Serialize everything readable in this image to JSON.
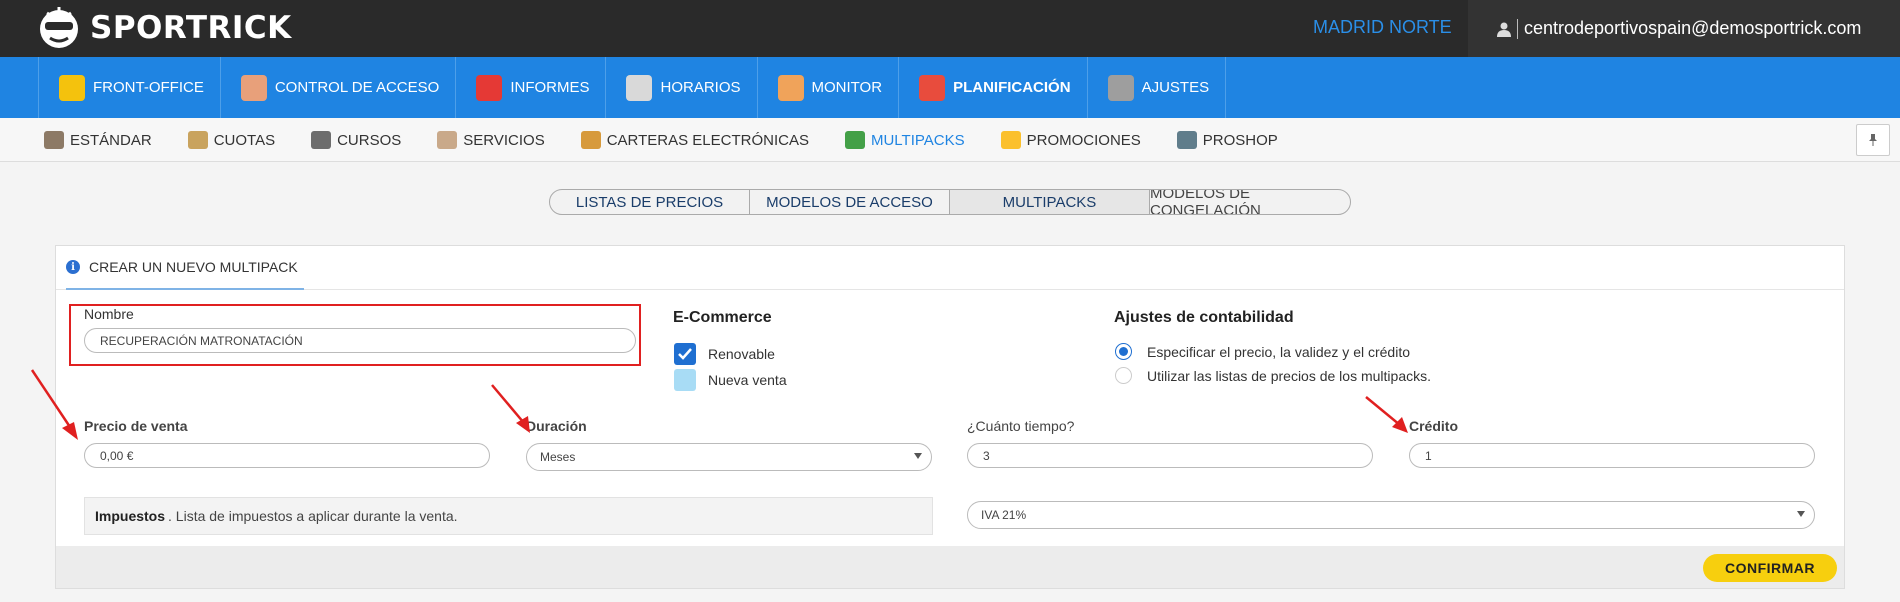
{
  "brand": {
    "name": "SPORTRICK"
  },
  "header": {
    "location": "MADRID NORTE",
    "user_email": "centrodeportivospain@demosportrick.com"
  },
  "main_nav": [
    {
      "label": "FRONT-OFFICE",
      "icon": "receptionist-icon",
      "color": "#f4c20d"
    },
    {
      "label": "CONTROL DE ACCESO",
      "icon": "turnstile-icon",
      "color": "#e8a07a"
    },
    {
      "label": "INFORMES",
      "icon": "pie-chart-icon",
      "color": "#e53935"
    },
    {
      "label": "HORARIOS",
      "icon": "calendar-icon",
      "color": "#d9d9d9"
    },
    {
      "label": "MONITOR",
      "icon": "people-icon",
      "color": "#f0a35a"
    },
    {
      "label": "PLANIFICACIÓN",
      "icon": "planner-calendar-icon",
      "color": "#e84c3d",
      "active": true
    },
    {
      "label": "AJUSTES",
      "icon": "gear-icon",
      "color": "#9e9e9e"
    }
  ],
  "sub_nav": [
    {
      "label": "ESTÁNDAR",
      "icon": "box-icon",
      "color": "#8d7a66"
    },
    {
      "label": "CUOTAS",
      "icon": "clipboard-icon",
      "color": "#c9a35e"
    },
    {
      "label": "CURSOS",
      "icon": "books-icon",
      "color": "#6d6d6d"
    },
    {
      "label": "SERVICIOS",
      "icon": "handshake-icon",
      "color": "#c9a98a"
    },
    {
      "label": "CARTERAS ELECTRÓNICAS",
      "icon": "wallet-icon",
      "color": "#d79a3c"
    },
    {
      "label": "MULTIPACKS",
      "icon": "multipack-icon",
      "color": "#43a047",
      "active": true
    },
    {
      "label": "PROMOCIONES",
      "icon": "star-icon",
      "color": "#fbc02d"
    },
    {
      "label": "PROSHOP",
      "icon": "cash-register-icon",
      "color": "#607d8b"
    }
  ],
  "pin_icon": "pin-icon",
  "segment_tabs": [
    {
      "label": "LISTAS DE PRECIOS"
    },
    {
      "label": "MODELOS DE ACCESO"
    },
    {
      "label": "MULTIPACKS",
      "active": true
    },
    {
      "label": "MODELOS DE CONGELACIÓN"
    }
  ],
  "card": {
    "title": "CREAR UN NUEVO MULTIPACK",
    "info_icon": "info-icon",
    "name_label": "Nombre",
    "name_value": "RECUPERACIÓN MATRONATACIÓN",
    "ecommerce": {
      "title": "E-Commerce",
      "renewable_label": "Renovable",
      "renewable_checked": true,
      "new_sale_label": "Nueva venta",
      "new_sale_checked": false
    },
    "accounting": {
      "title": "Ajustes de contabilidad",
      "option_specify": "Especificar el precio, la validez y el crédito",
      "option_lists": "Utilizar las listas de precios de los multipacks.",
      "selected": "specify"
    },
    "price_label": "Precio de venta",
    "price_value": "0,00 €",
    "duration_label": "Duración",
    "duration_value": "Meses",
    "time_label": "¿Cuánto tiempo?",
    "time_value": "3",
    "credit_label": "Crédito",
    "credit_value": "1",
    "tax_label": "Impuestos",
    "tax_desc": ". Lista de impuestos a aplicar durante la venta.",
    "tax_value": "IVA 21%",
    "confirm_label": "CONFIRMAR"
  },
  "colors": {
    "nav_blue": "#1f84e2",
    "topbar": "#2a2a2a",
    "confirm": "#f7cf0e",
    "highlight_red": "#e02020"
  }
}
